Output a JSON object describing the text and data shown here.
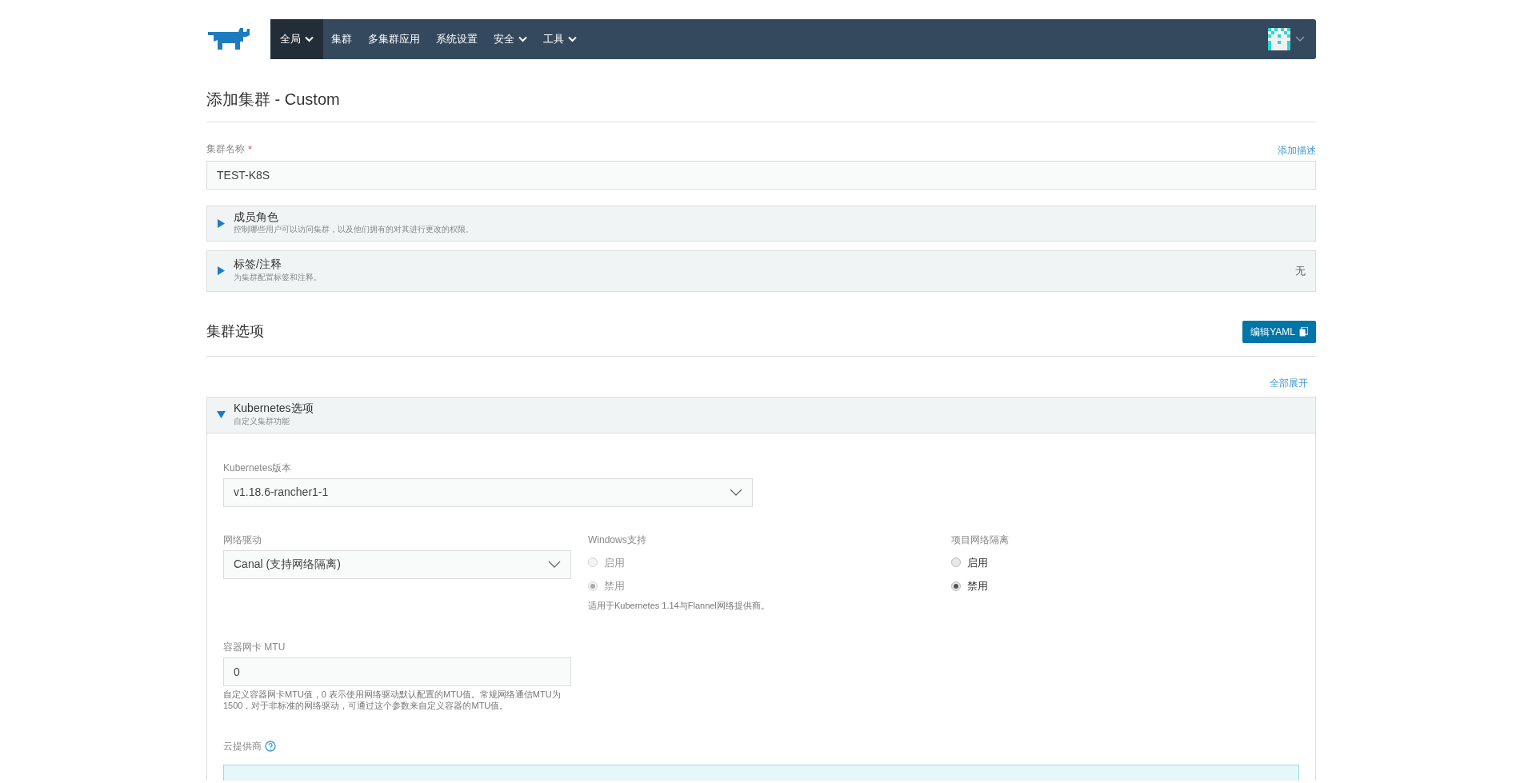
{
  "navbar": {
    "items": [
      {
        "label": "全局",
        "kind": "dropdown",
        "selected": true
      },
      {
        "label": "集群",
        "kind": "link",
        "selected": false
      },
      {
        "label": "多集群应用",
        "kind": "link",
        "selected": false
      },
      {
        "label": "系统设置",
        "kind": "link",
        "selected": false
      },
      {
        "label": "安全",
        "kind": "dropdown",
        "selected": false
      },
      {
        "label": "工具",
        "kind": "dropdown",
        "selected": false
      }
    ]
  },
  "page_title": "添加集群 - Custom",
  "cluster_name": {
    "label": "集群名称",
    "required_mark": "*",
    "value": "TEST-K8S",
    "add_description": "添加描述"
  },
  "accordions": [
    {
      "title": "成员角色",
      "subtitle": "控制哪些用户可以访问集群，以及他们拥有的对其进行更改的权限。",
      "expanded": false
    },
    {
      "title": "标签/注释",
      "subtitle": "为集群配置标签和注释。",
      "expanded": false,
      "status": "无"
    }
  ],
  "cluster_options": {
    "title": "集群选项",
    "edit_yaml_button": "编辑YAML",
    "expand_all": "全部展开"
  },
  "kubernetes_section": {
    "title": "Kubernetes选项",
    "subtitle": "自定义集群功能",
    "expanded": true,
    "version": {
      "label": "Kubernetes版本",
      "value": "v1.18.6-rancher1-1"
    },
    "network_provider": {
      "label": "网络驱动",
      "value": "Canal (支持网络隔离)"
    },
    "radio_groups": [
      {
        "label": "Windows支持",
        "disabled": true,
        "options": [
          {
            "label": "启用",
            "selected": false
          },
          {
            "label": "禁用",
            "selected": true
          }
        ],
        "help": "适用于Kubernetes 1.14与Flannel网络提供商。"
      },
      {
        "label": "项目网络隔离",
        "disabled": false,
        "options": [
          {
            "label": "启用",
            "selected": false
          },
          {
            "label": "禁用",
            "selected": true
          }
        ]
      }
    ],
    "mtu": {
      "label": "容器网卡 MTU",
      "value": "0",
      "help": "自定义容器网卡MTU值，0 表示使用网络驱动默认配置的MTU值。常规网络通信MTU为1500，对于非标准的网络驱动，可通过这个参数来自定义容器的MTU值。"
    },
    "cloud_provider": {
      "label": "云提供商"
    }
  }
}
